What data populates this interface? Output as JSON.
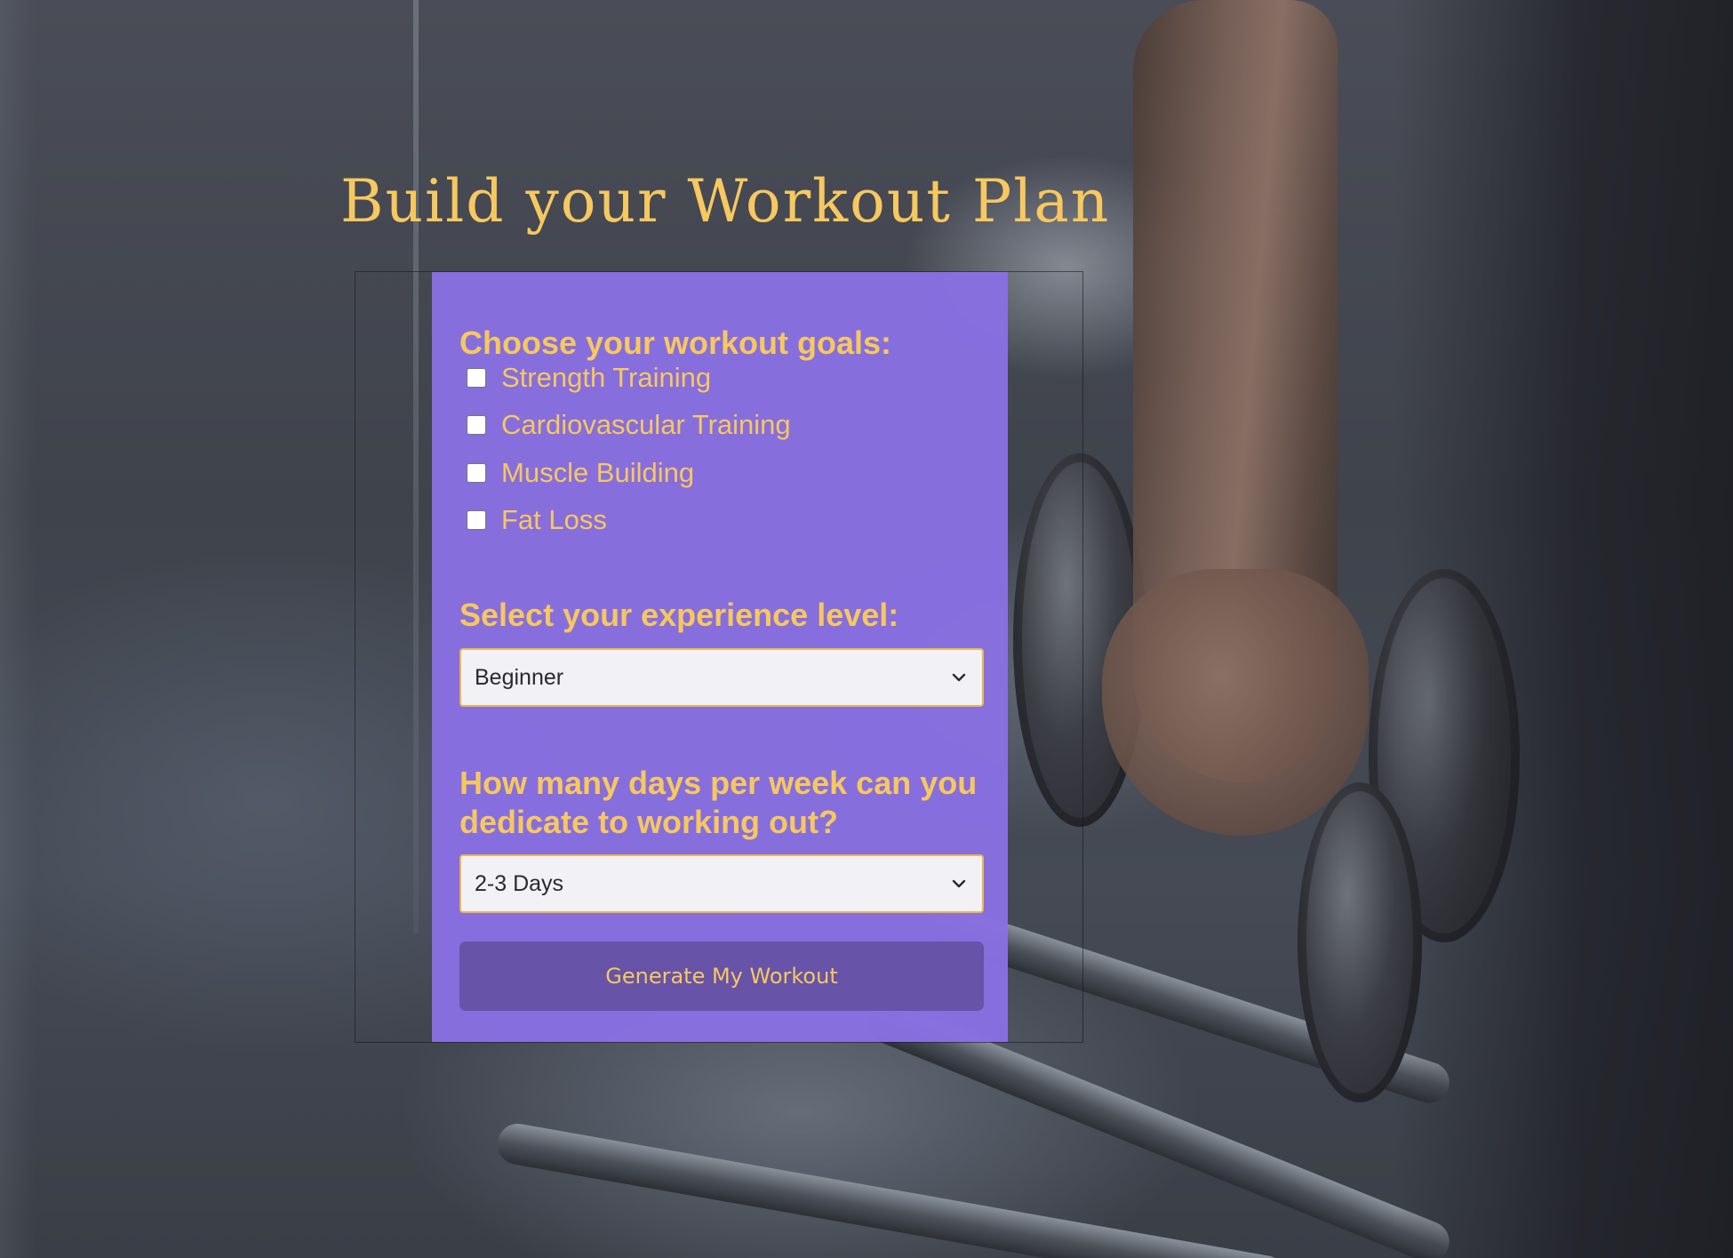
{
  "page": {
    "title": "Build your Workout Plan"
  },
  "form": {
    "goals": {
      "label": "Choose your workout goals:",
      "options": [
        {
          "label": "Strength Training",
          "checked": false
        },
        {
          "label": "Cardiovascular Training",
          "checked": false
        },
        {
          "label": "Muscle Building",
          "checked": false
        },
        {
          "label": "Fat Loss",
          "checked": false
        }
      ]
    },
    "experience": {
      "label": "Select your experience level:",
      "selected": "Beginner"
    },
    "days": {
      "label": "How many days per week can you dedicate to working out?",
      "selected": "2-3 Days"
    },
    "submit_label": "Generate My Workout"
  },
  "icons": {
    "select_arrow": "chevron-down-icon",
    "background": "gym-dumbbell-photo"
  },
  "colors": {
    "accent_gold": "#f6c85f",
    "panel_purple": "#8970e2",
    "button_purple": "#6753a8",
    "select_background": "#f2f1f6"
  }
}
